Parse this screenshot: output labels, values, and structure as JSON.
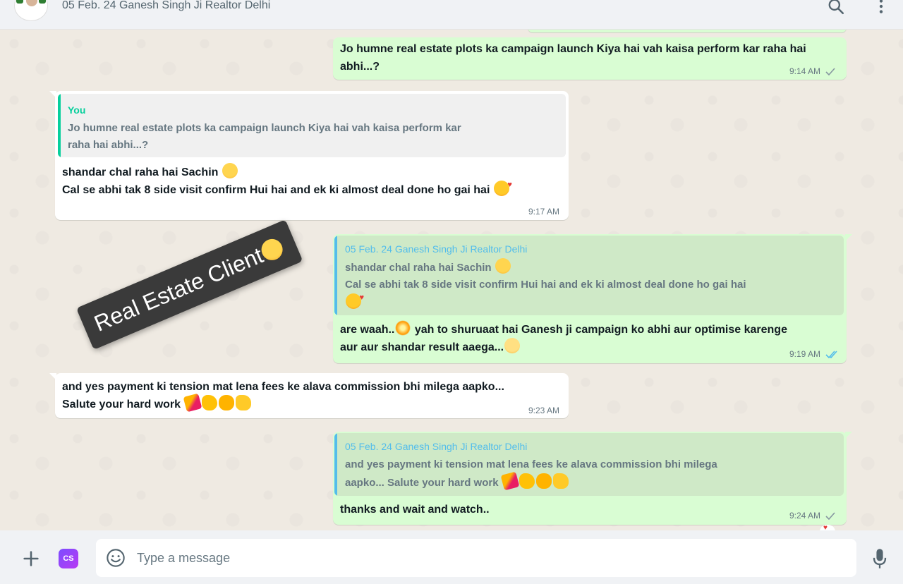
{
  "header": {
    "title": "05 Feb. 24 Ganesh Singh Ji Realtor Delhi",
    "icons": [
      "search-icon",
      "menu-icon"
    ]
  },
  "messages": [
    {
      "direction": "outgoing",
      "lines": [
        "Jo humne real estate plots ka campaign launch Kiya hai vah kaisa perform kar raha hai",
        "abhi...?"
      ],
      "time": "9:14 AM",
      "status": "sent"
    },
    {
      "direction": "incoming",
      "quote": {
        "author": "You",
        "lines": [
          "Jo humne real estate plots ka campaign launch Kiya hai vah kaisa perform kar",
          "raha hai abhi...?"
        ]
      },
      "lines": [
        "shandar chal raha hai Sachin",
        "Cal se abhi tak 8 side visit confirm Hui hai and ek ki almost deal done ho gai hai"
      ],
      "time": "9:17 AM"
    },
    {
      "direction": "outgoing",
      "quote": {
        "author": "05 Feb. 24 Ganesh Singh Ji Realtor Delhi",
        "lines": [
          "shandar chal raha hai Sachin",
          "Cal se abhi tak 8 side visit confirm Hui hai and ek ki almost deal done ho gai hai"
        ]
      },
      "lines": [
        "are waah..",
        "yah to shuruaat hai Ganesh ji campaign ko abhi aur optimise karenge",
        "aur aur shandar result aaega..."
      ],
      "time": "9:19 AM",
      "status": "read"
    },
    {
      "direction": "incoming",
      "lines": [
        "and yes payment ki tension mat lena fees ke alava commission bhi milega aapko...",
        "Salute your hard work"
      ],
      "time": "9:23 AM"
    },
    {
      "direction": "outgoing",
      "quote": {
        "author": "05 Feb. 24 Ganesh Singh Ji Realtor Delhi",
        "lines": [
          "and yes payment ki tension mat lena fees ke alava commission bhi milega",
          "aapko... Salute your hard work"
        ]
      },
      "lines": [
        "thanks and wait and watch.."
      ],
      "time": "9:24 AM",
      "status": "sent"
    }
  ],
  "sticker": {
    "text": "Real Estate Client"
  },
  "composer": {
    "placeholder": "Type a message",
    "value": "",
    "icons": [
      "plus-icon",
      "cs-extension-icon",
      "emoji-icon",
      "mic-icon"
    ],
    "extension_label": "CS"
  },
  "colors": {
    "outgoing_bubble": "#d9fdd3",
    "incoming_bubble": "#ffffff",
    "you_author": "#06cf9c",
    "contact_author": "#53bdeb",
    "read_tick": "#53bdeb"
  }
}
